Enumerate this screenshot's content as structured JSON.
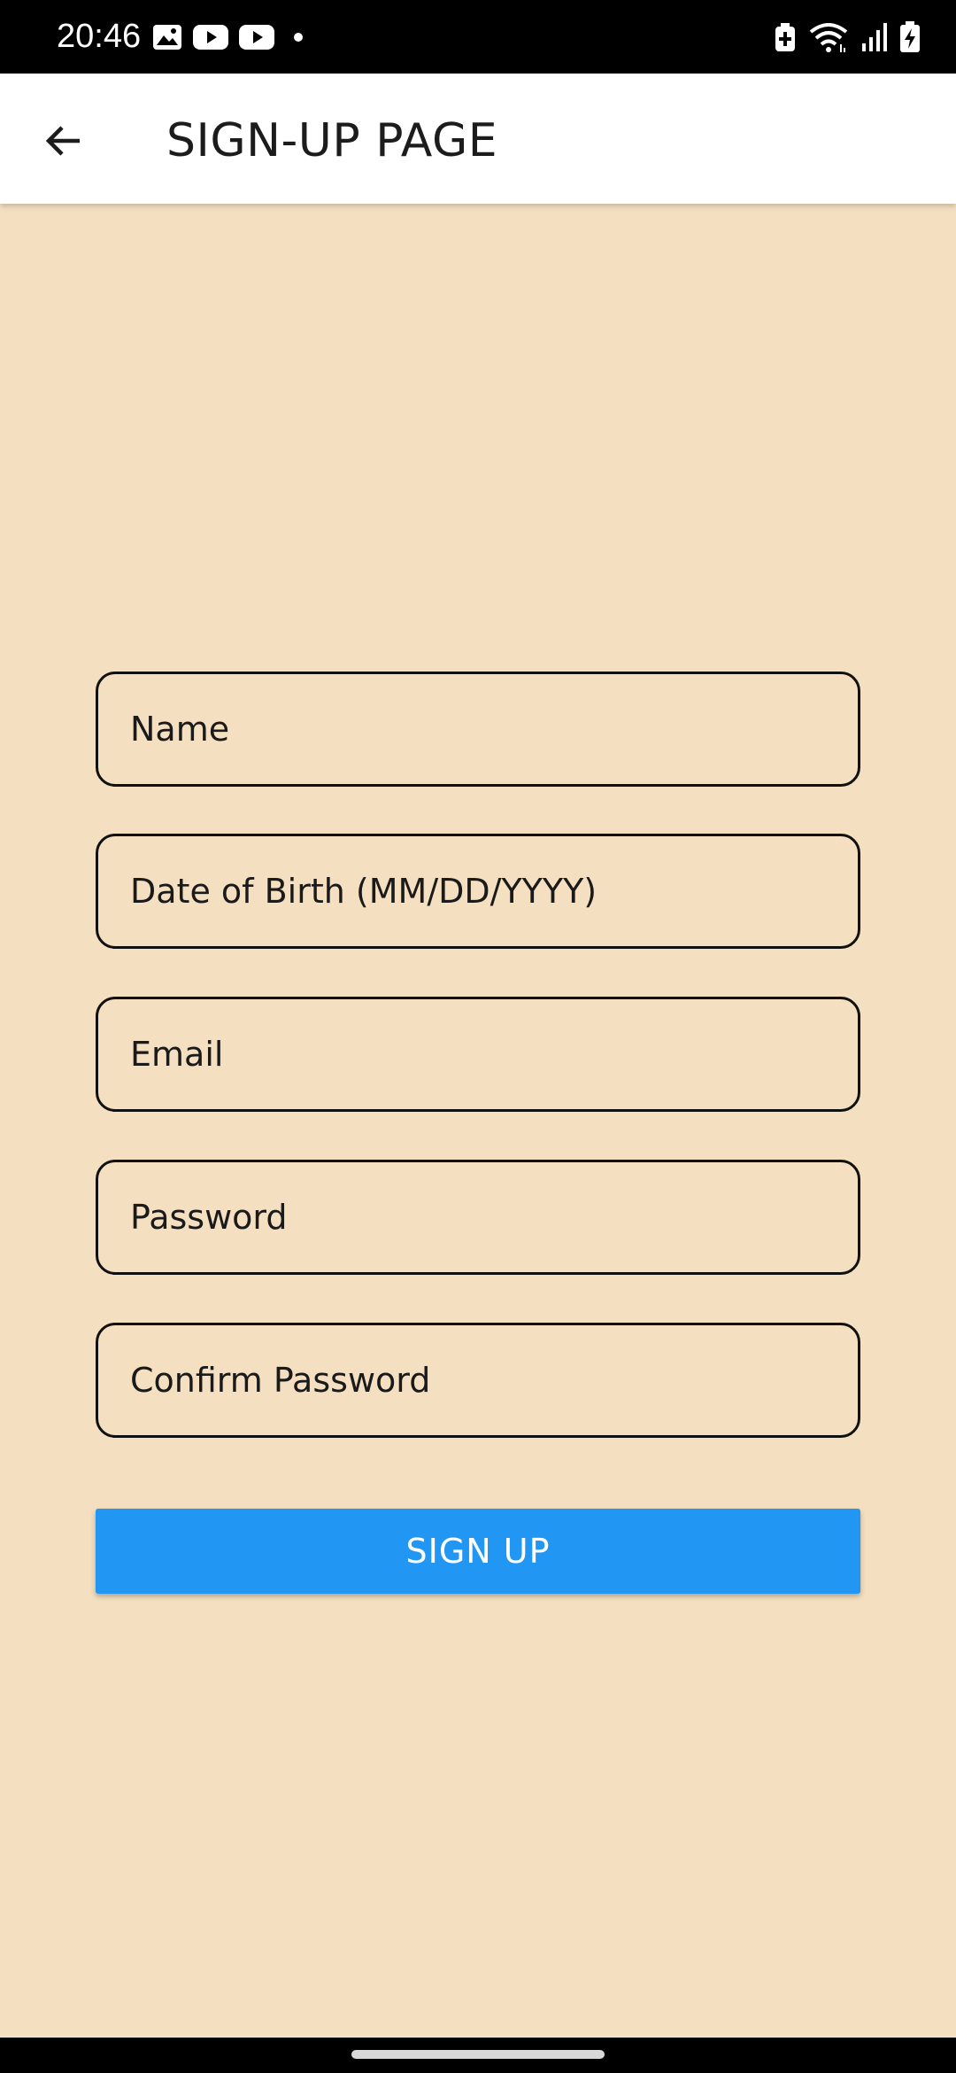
{
  "status_bar": {
    "time": "20:46",
    "left_icons": [
      "gallery-icon",
      "youtube-icon",
      "youtube-icon",
      "dot-icon"
    ],
    "right_icons": [
      "battery-saver-icon",
      "wifi-icon",
      "signal-icon",
      "battery-charging-icon"
    ]
  },
  "app_bar": {
    "title": "SIGN-UP PAGE",
    "back_icon": "arrow-left-icon"
  },
  "form": {
    "name_placeholder": "Name",
    "dob_placeholder": "Date of Birth (MM/DD/YYYY)",
    "email_placeholder": "Email",
    "password_placeholder": "Password",
    "confirm_password_placeholder": "Confirm Password",
    "name_value": "",
    "dob_value": "",
    "email_value": "",
    "password_value": "",
    "confirm_password_value": "",
    "submit_label": "SIGN UP"
  },
  "colors": {
    "background": "#f4dfc0",
    "app_bar": "#ffffff",
    "primary_button": "#2196f3",
    "status_bar": "#000000"
  }
}
